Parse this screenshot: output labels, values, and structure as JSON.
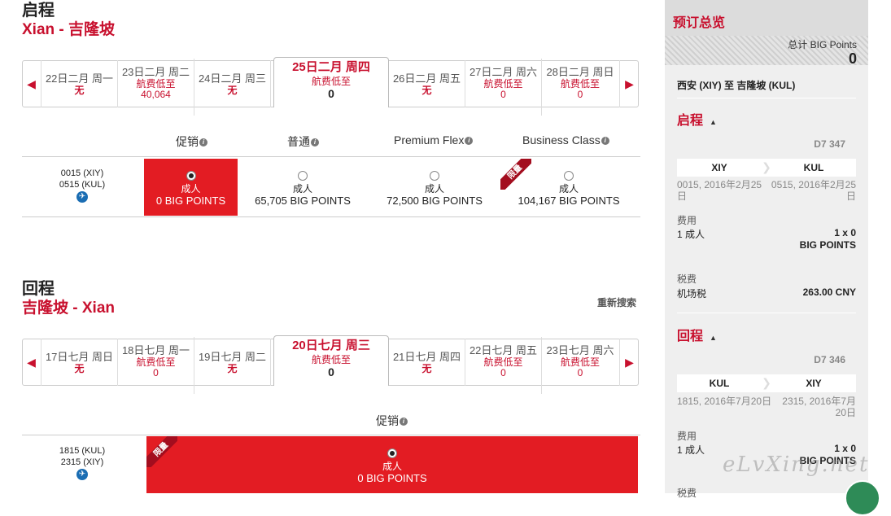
{
  "outbound": {
    "heading": "启程",
    "route": "Xian - 吉隆坡",
    "dates": [
      {
        "date": "22日二月 周一",
        "status": "无",
        "fare": ""
      },
      {
        "date": "23日二月 周二",
        "status": "航费低至",
        "fare": "40,064"
      },
      {
        "date": "24日二月 周三",
        "status": "无",
        "fare": ""
      },
      {
        "date": "25日二月 周四",
        "status": "航费低至",
        "fare": "0"
      },
      {
        "date": "26日二月 周五",
        "status": "无",
        "fare": ""
      },
      {
        "date": "27日二月 周六",
        "status": "航费低至",
        "fare": "0"
      },
      {
        "date": "28日二月 周日",
        "status": "航费低至",
        "fare": "0"
      }
    ],
    "columns": [
      "促销",
      "普通",
      "Premium Flex",
      "Business Class"
    ],
    "flight": {
      "depart": "0015 (XIY)",
      "arrive": "0515 (KUL)"
    },
    "fares": [
      {
        "pax": "成人",
        "points": "0 BIG POINTS"
      },
      {
        "pax": "成人",
        "points": "65,705 BIG POINTS"
      },
      {
        "pax": "成人",
        "points": "72,500 BIG POINTS"
      },
      {
        "pax": "成人",
        "points": "104,167 BIG POINTS"
      }
    ],
    "ribbon": "限量"
  },
  "inbound": {
    "heading": "回程",
    "route": "吉隆坡 - Xian",
    "research": "重新搜索",
    "dates": [
      {
        "date": "17日七月 周日",
        "status": "无",
        "fare": ""
      },
      {
        "date": "18日七月 周一",
        "status": "航费低至",
        "fare": "0"
      },
      {
        "date": "19日七月 周二",
        "status": "无",
        "fare": ""
      },
      {
        "date": "20日七月 周三",
        "status": "航费低至",
        "fare": "0"
      },
      {
        "date": "21日七月 周四",
        "status": "无",
        "fare": ""
      },
      {
        "date": "22日七月 周五",
        "status": "航费低至",
        "fare": "0"
      },
      {
        "date": "23日七月 周六",
        "status": "航费低至",
        "fare": "0"
      }
    ],
    "column": "促销",
    "flight": {
      "depart": "1815 (KUL)",
      "arrive": "2315 (XIY)"
    },
    "fare": {
      "pax": "成人",
      "points": "0 BIG POINTS"
    },
    "ribbon": "限量"
  },
  "summary": {
    "title": "预订总览",
    "total_label": "总计 BIG Points",
    "total_value": "0",
    "route": "西安 (XIY) 至 吉隆坡 (KUL)",
    "outbound": {
      "label": "启程",
      "flight_no": "D7 347",
      "from": "XIY",
      "to": "KUL",
      "dep_time": "0015, 2016年2月25日",
      "arr_time": "0515, 2016年2月25日",
      "fee_label": "费用",
      "pax": "1 成人",
      "qty": "1 x 0",
      "unit": "BIG POINTS",
      "tax_label": "税费",
      "tax_item": "机场税",
      "tax_value": "263.00 CNY"
    },
    "inbound": {
      "label": "回程",
      "flight_no": "D7 346",
      "from": "KUL",
      "to": "XIY",
      "dep_time": "1815, 2016年7月20日",
      "arr_time": "2315, 2016年7月20日",
      "fee_label": "费用",
      "pax": "1 成人",
      "qty": "1 x 0",
      "unit": "BIG POINTS",
      "tax_label": "税费"
    }
  },
  "watermark": "eLvXing.net",
  "colors": {
    "brand_red": "#c8102e",
    "selected_fare": "#e31c23"
  }
}
